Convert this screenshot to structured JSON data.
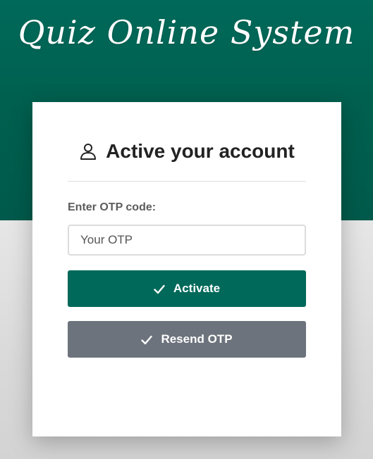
{
  "brand": {
    "title": "Quiz Online System"
  },
  "card": {
    "header_icon": "user-icon",
    "title": "Active your account"
  },
  "form": {
    "otp_label": "Enter OTP code:",
    "otp_placeholder": "Your OTP",
    "otp_value": ""
  },
  "buttons": {
    "activate_label": "Activate",
    "activate_icon": "check-icon",
    "resend_label": "Resend OTP",
    "resend_icon": "check-icon"
  },
  "colors": {
    "brand_green": "#00695a",
    "secondary_gray": "#6c737c",
    "background_gray": "#d9d9d9"
  }
}
